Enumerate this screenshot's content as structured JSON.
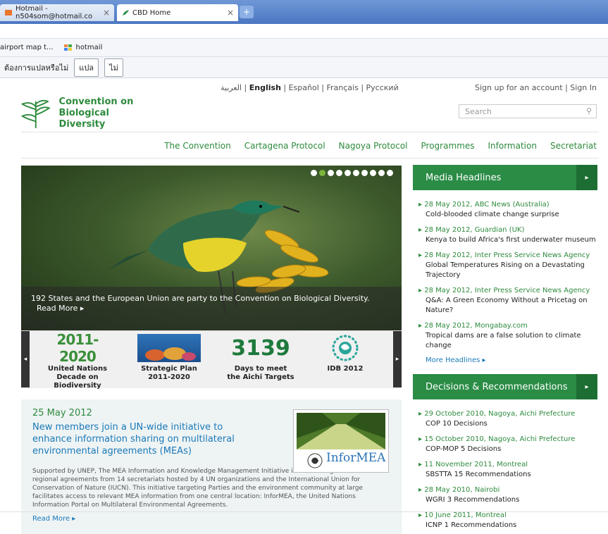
{
  "browser": {
    "tabs": [
      {
        "label": "Hotmail - n504som@hotmail.co"
      },
      {
        "label": "CBD Home"
      }
    ],
    "bookmarks": [
      {
        "label": "airport map t..."
      },
      {
        "label": "hotmail"
      }
    ],
    "translate_bar": {
      "question": "ต้องการแปลหรือไม่",
      "translate_label": "แปล",
      "no_label": "ไม่"
    }
  },
  "header": {
    "languages": [
      "العربية",
      "English",
      "Español",
      "Français",
      "Русский"
    ],
    "account_links": [
      "Sign up for an account",
      "Sign In"
    ],
    "logo_line1": "Convention on",
    "logo_line2": "Biological Diversity",
    "search_placeholder": "Search"
  },
  "nav": [
    "The Convention",
    "Cartagena Protocol",
    "Nagoya Protocol",
    "Programmes",
    "Information",
    "Secretariat"
  ],
  "hero": {
    "caption": "192 States and the European Union are party to the Convention on Biological Diversity.",
    "read_more": "Read More",
    "slide_count": 10,
    "active_slide": 0
  },
  "thumbs": [
    {
      "art": "2011-2020",
      "caption_lines": [
        "United Nations",
        "Decade on Biodiversity"
      ]
    },
    {
      "art": "",
      "caption_lines": [
        "Strategic Plan",
        "2011-2020"
      ]
    },
    {
      "art": "3139",
      "caption_lines": [
        "Days to meet",
        "the Aichi Targets"
      ]
    },
    {
      "art": "",
      "caption_lines": [
        "IDB 2012"
      ]
    }
  ],
  "news": {
    "date": "25 May 2012",
    "title": "New members join a UN-wide initiative to enhance information sharing on multilateral environmental agreements (MEAs)",
    "image_label": "InforMEA",
    "body": "Supported by UNEP, The MEA Information and Knowledge Management Initiative includes 40 global and regional agreements from 14 secretariats hosted by 4 UN organizations and the International Union for Conservation of Nature (IUCN). This initiative targeting Parties and the environment community at large facilitates access to relevant MEA information from one central location: InforMEA, the United Nations Information Portal on Multilateral Environmental Agreements.",
    "read_more": "Read More"
  },
  "media_headlines": {
    "title": "Media Headlines",
    "items": [
      {
        "meta": "28 May 2012, ABC News (Australia)",
        "text": "Cold-blooded climate change surprise"
      },
      {
        "meta": "28 May 2012, Guardian (UK)",
        "text": "Kenya to build Africa's first underwater museum"
      },
      {
        "meta": "28 May 2012, Inter Press Service News Agency",
        "text": "Global Temperatures Rising on a Devastating Trajectory"
      },
      {
        "meta": "28 May 2012, Inter Press Service News Agency",
        "text": "Q&A: A Green Economy Without a Pricetag on Nature?"
      },
      {
        "meta": "28 May 2012, Mongabay.com",
        "text": "Tropical dams are a false solution to climate change"
      }
    ],
    "more": "More Headlines"
  },
  "decisions": {
    "title": "Decisions & Recommendations",
    "items": [
      {
        "meta": "29 October 2010, Nagoya, Aichi Prefecture",
        "text": "COP 10 Decisions"
      },
      {
        "meta": "15 October 2010, Nagoya, Aichi Prefecture",
        "text": "COP-MOP 5 Decisions"
      },
      {
        "meta": "11 November 2011, Montreal",
        "text": "SBSTTA 15 Recommendations"
      },
      {
        "meta": "28 May 2010, Nairobi",
        "text": "WGRI 3 Recommendations"
      },
      {
        "meta": "10 June 2011, Montreal",
        "text": "ICNP 1 Recommendations"
      }
    ]
  },
  "colors": {
    "brand_green": "#2a8c45",
    "link_blue": "#1a7ab8"
  }
}
